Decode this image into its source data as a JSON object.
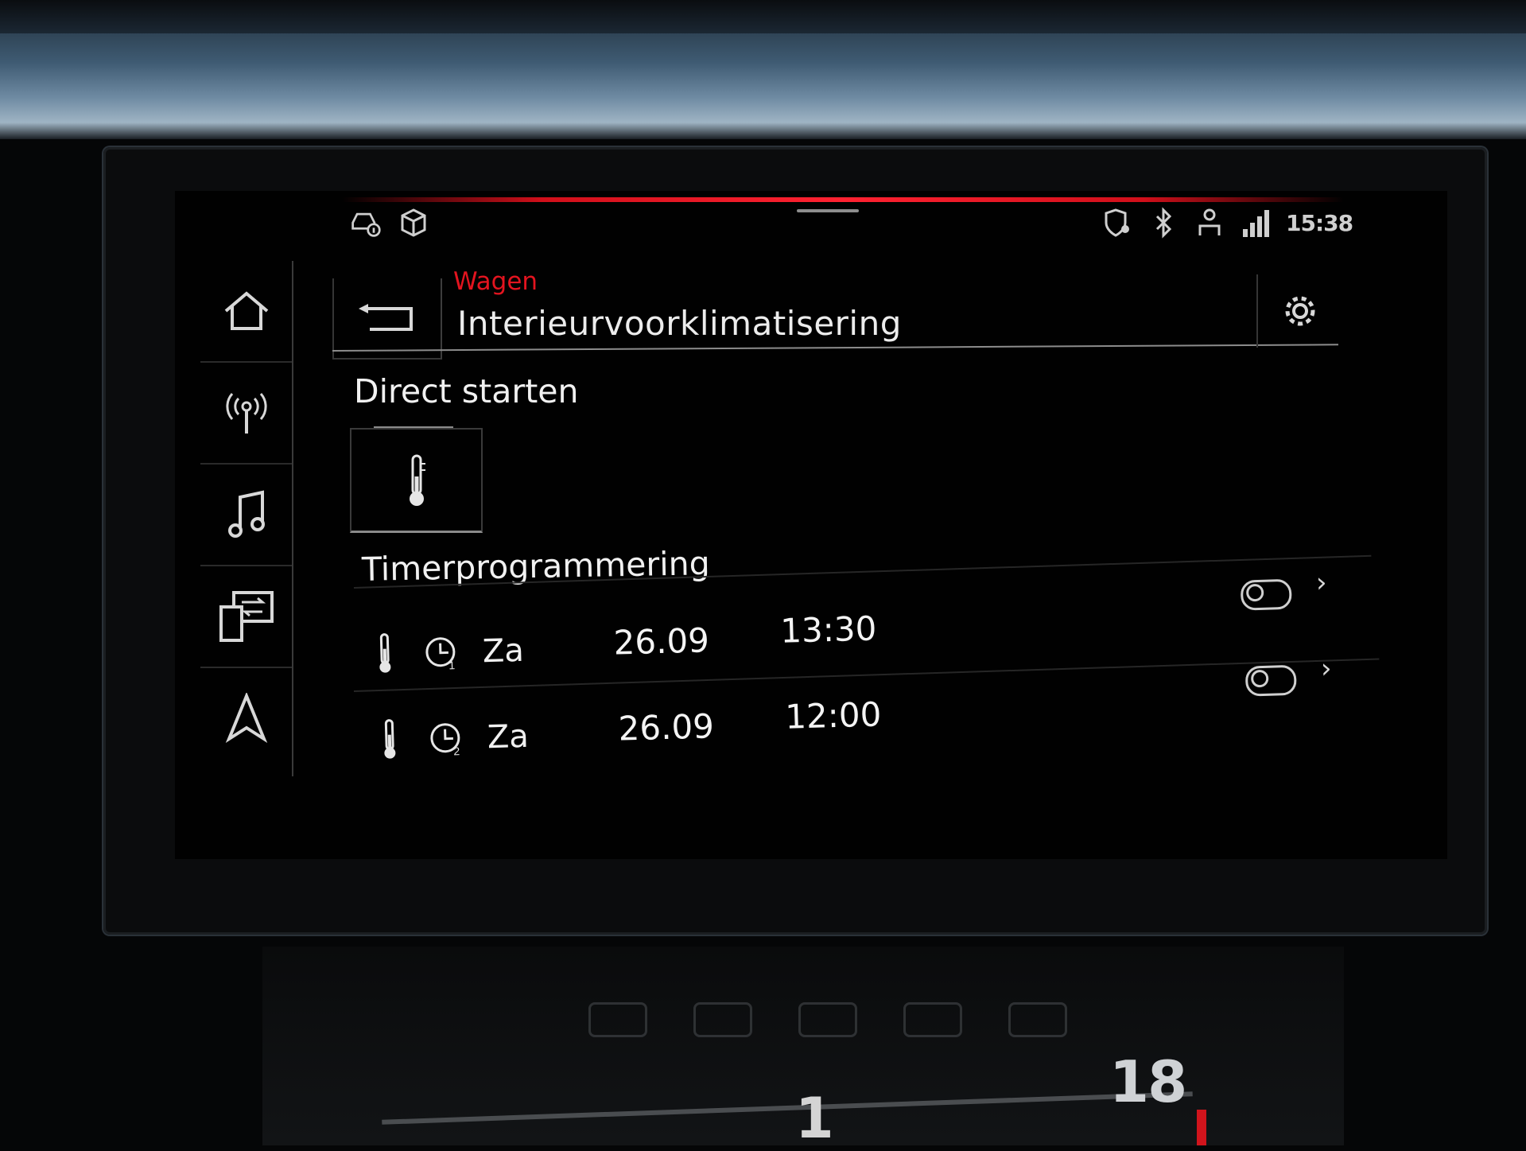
{
  "status_bar": {
    "clock": "15:38",
    "left_icons": [
      "car-info-icon",
      "cube-icon"
    ],
    "right_icons": [
      "location-shield-icon",
      "bluetooth-icon",
      "user-icon",
      "signal-icon"
    ]
  },
  "sidebar": {
    "items": [
      {
        "icon": "home-icon"
      },
      {
        "icon": "radio-antenna-icon"
      },
      {
        "icon": "music-icon"
      },
      {
        "icon": "phone-connect-icon"
      },
      {
        "icon": "navigation-icon"
      }
    ]
  },
  "header": {
    "breadcrumb": "Wagen",
    "title": "Interieurvoorklimatisering"
  },
  "direct": {
    "title": "Direct starten"
  },
  "timer": {
    "title": "Timerprogrammering",
    "rows": [
      {
        "timer_number": "1",
        "day": "Za",
        "date": "26.09",
        "time": "13:30",
        "enabled": false
      },
      {
        "timer_number": "2",
        "day": "Za",
        "date": "26.09",
        "time": "12:00",
        "enabled": false
      }
    ]
  },
  "console": {
    "temperature": "18",
    "fan_level": "1"
  },
  "colors": {
    "accent_red": "#e3141f",
    "screen_bg": "#010101",
    "text": "#ececec"
  }
}
